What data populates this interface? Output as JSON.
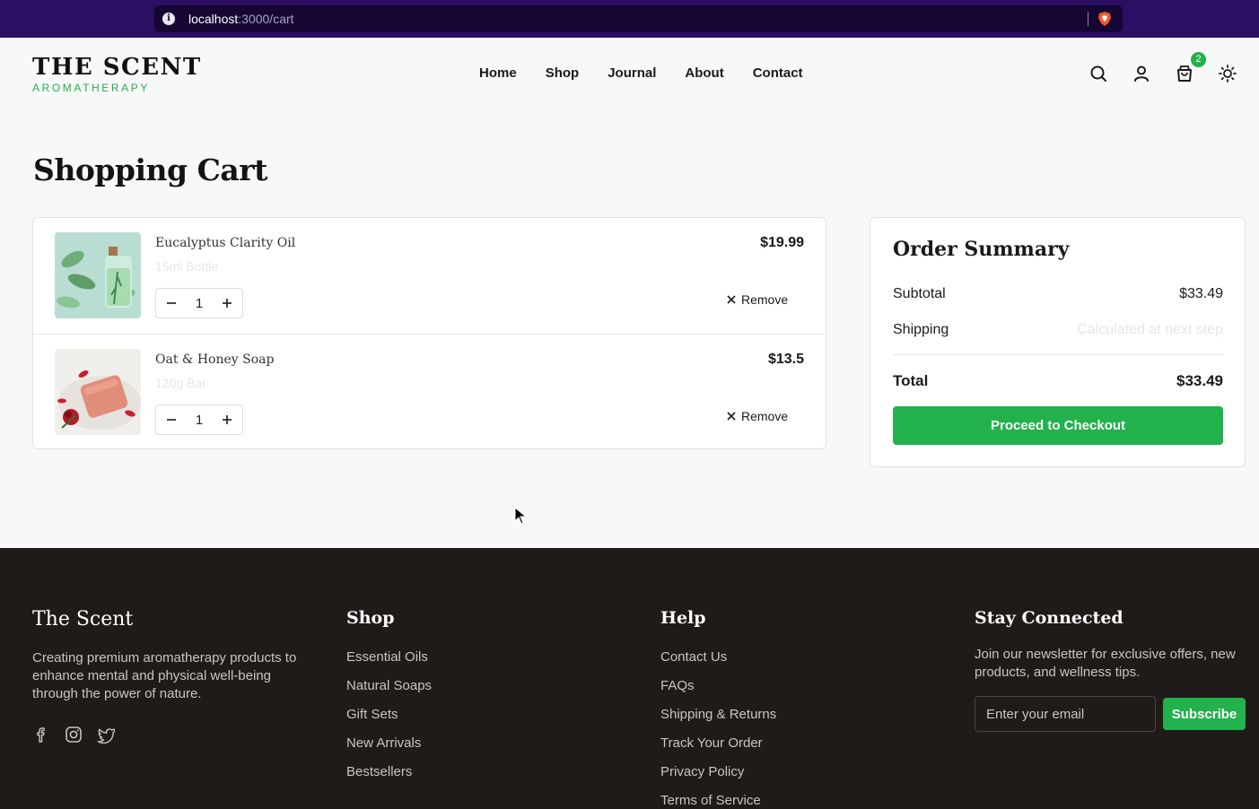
{
  "browser": {
    "url_host": "localhost",
    "url_path": ":3000/cart"
  },
  "header": {
    "logo_title": "THE SCENT",
    "logo_subtitle": "AROMATHERAPY",
    "nav": [
      "Home",
      "Shop",
      "Journal",
      "About",
      "Contact"
    ],
    "cart_count": "2",
    "icons": [
      "search-icon",
      "user-icon",
      "cart-icon",
      "sun-icon"
    ]
  },
  "page": {
    "title": "Shopping Cart"
  },
  "cart": {
    "items": [
      {
        "name": "Eucalyptus Clarity Oil",
        "variant": "15ml Bottle",
        "quantity": "1",
        "price": "$19.99",
        "remove_label": "Remove"
      },
      {
        "name": "Oat & Honey Soap",
        "variant": "120g Bar",
        "quantity": "1",
        "price": "$13.5",
        "remove_label": "Remove"
      }
    ]
  },
  "summary": {
    "title": "Order Summary",
    "subtotal_label": "Subtotal",
    "subtotal_value": "$33.49",
    "shipping_label": "Shipping",
    "shipping_value": "Calculated at next step",
    "total_label": "Total",
    "total_value": "$33.49",
    "checkout_label": "Proceed to Checkout"
  },
  "footer": {
    "brand": "The Scent",
    "description": "Creating premium aromatherapy products to enhance mental and physical well-being through the power of nature.",
    "social_icons": [
      "facebook-icon",
      "instagram-icon",
      "twitter-icon"
    ],
    "shop_heading": "Shop",
    "shop_links": [
      "Essential Oils",
      "Natural Soaps",
      "Gift Sets",
      "New Arrivals",
      "Bestsellers"
    ],
    "help_heading": "Help",
    "help_links": [
      "Contact Us",
      "FAQs",
      "Shipping & Returns",
      "Track Your Order",
      "Privacy Policy",
      "Terms of Service"
    ],
    "news_heading": "Stay Connected",
    "news_text": "Join our newsletter for exclusive offers, new products, and wellness tips.",
    "email_placeholder": "Enter your email",
    "subscribe_label": "Subscribe"
  },
  "colors": {
    "accent": "#22b14c",
    "footer_bg": "#1f1b18",
    "browser_bar": "#2a0f62"
  }
}
